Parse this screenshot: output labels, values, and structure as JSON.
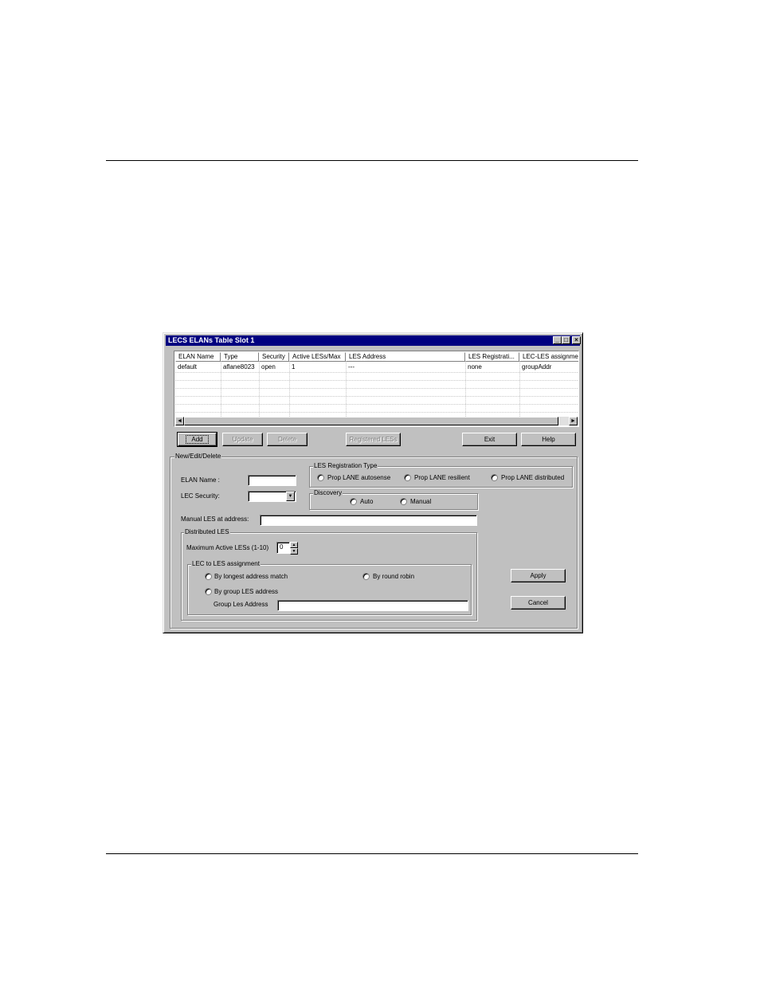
{
  "window": {
    "title": "LECS ELANs Table  Slot 1",
    "min_glyph": "_",
    "max_glyph": "□",
    "close_glyph": "×"
  },
  "table": {
    "columns": [
      "ELAN Name",
      "Type",
      "Security",
      "Active LESs/Max",
      "LES Address",
      "LES Registrati...",
      "LEC-LES assignmen"
    ],
    "rows": [
      [
        "default",
        "aflane8023",
        "open",
        "1",
        "---",
        "none",
        "groupAddr"
      ]
    ],
    "scroll_left": "◄",
    "scroll_right": "►"
  },
  "buttons": {
    "add": "Add",
    "update": "Update",
    "delete": "Delete",
    "registered_less": "Registered LESs",
    "exit": "Exit",
    "help": "Help",
    "apply": "Apply",
    "cancel": "Cancel"
  },
  "form": {
    "group_title": "New/Edit/Delete",
    "elan_name_label": "ELAN Name :",
    "elan_name_value": "",
    "lec_security_label": "LEC Security:",
    "lec_security_value": "",
    "combo_arrow": "▼",
    "les_reg_type": {
      "title": "LES Registration Type",
      "options": [
        "Prop LANE autosense",
        "Prop LANE resilient",
        "Prop LANE distributed"
      ]
    },
    "discovery": {
      "title": "Discovery",
      "options": [
        "Auto",
        "Manual"
      ]
    },
    "manual_les_label": "Manual LES at address:",
    "manual_les_value": "",
    "distributed_les": {
      "title": "Distributed LES",
      "max_active_label": "Maximum Active LESs (1-10)",
      "max_active_value": "0",
      "spin_up": "▲",
      "spin_down": "▼"
    },
    "lec_to_les": {
      "title": "LEC to LES assignment",
      "options": [
        "By longest address match",
        "By round robin",
        "By group LES address"
      ],
      "group_les_label": "Group Les Address",
      "group_les_value": ""
    }
  }
}
